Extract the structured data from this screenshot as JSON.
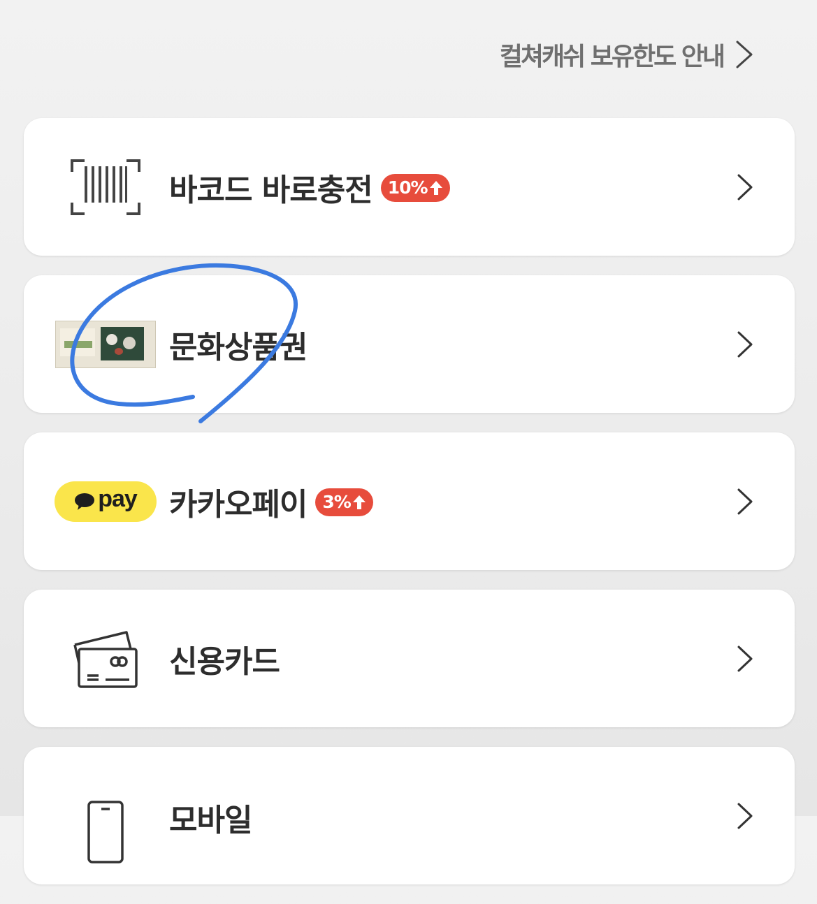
{
  "header": {
    "limit_info_link": "컬쳐캐쉬 보유한도 안내"
  },
  "menu": {
    "items": [
      {
        "label": "바코드 바로충전",
        "badge": "10%",
        "icon": "barcode-scan-icon"
      },
      {
        "label": "문화상품권",
        "badge": "",
        "icon": "gift-certificate-image"
      },
      {
        "label": "카카오페이",
        "badge": "3%",
        "icon": "kakaopay-logo",
        "logo_text": "pay"
      },
      {
        "label": "신용카드",
        "badge": "",
        "icon": "credit-card-icon"
      },
      {
        "label": "모바일",
        "badge": "",
        "icon": "mobile-phone-icon"
      }
    ]
  },
  "colors": {
    "badge": "#e74c3c",
    "kakao_yellow": "#fae54b",
    "annotation_stroke": "#3b7ae0",
    "background": "#ededed",
    "card": "#ffffff"
  }
}
